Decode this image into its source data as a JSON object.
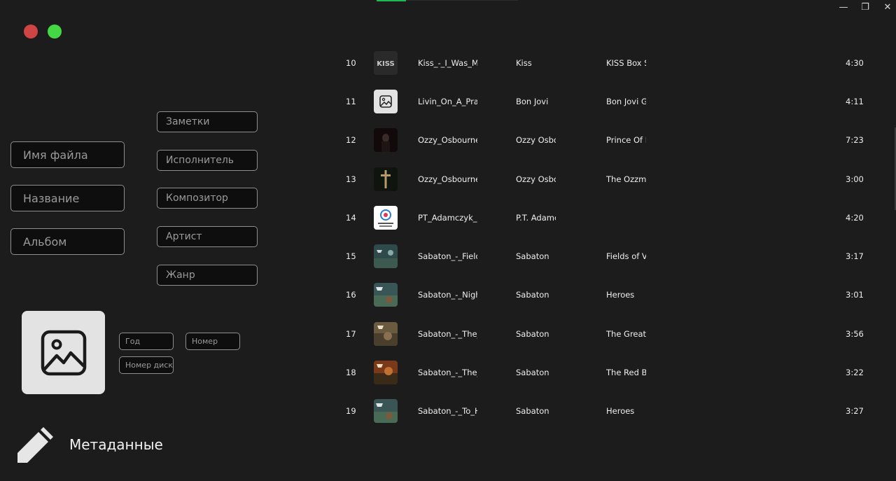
{
  "window": {
    "minimize": "—",
    "maximize": "❐",
    "close": "✕"
  },
  "metadata": {
    "fields": {
      "filename": "Имя файла",
      "title": "Название",
      "album": "Альбом",
      "notes": "Заметки",
      "performer": "Исполнитель",
      "composer": "Композитор",
      "artist": "Артист",
      "genre": "Жанр",
      "year": "Год",
      "track_number": "Номер",
      "disc_number": "Номер диска"
    },
    "section_label": "Метаданные"
  },
  "tracks": [
    {
      "num": "10",
      "title": "Kiss_-_I_Was_Ma",
      "artist": "Kiss",
      "album": "KISS Box Se",
      "duration": "4:30",
      "thumb": "kiss-logo-icon"
    },
    {
      "num": "11",
      "title": "Livin_On_A_Pray",
      "artist": "Bon Jovi",
      "album": "Bon Jovi Gr",
      "duration": "4:11",
      "thumb": "image-placeholder-icon"
    },
    {
      "num": "12",
      "title": "Ozzy_Osbourne_",
      "artist": "Ozzy Osbou",
      "album": "Prince Of D",
      "duration": "7:23",
      "thumb": "album-art"
    },
    {
      "num": "13",
      "title": "Ozzy_Osbourne_",
      "artist": "Ozzy Osbou",
      "album": "The Ozzma",
      "duration": "3:00",
      "thumb": "cross-art"
    },
    {
      "num": "14",
      "title": "PT_Adamczyk_-_",
      "artist": "P.T. Adamcz",
      "album": "",
      "duration": "4:20",
      "thumb": "free-music-logo"
    },
    {
      "num": "15",
      "title": "Sabaton_-_Fields",
      "artist": "Sabaton",
      "album": "Fields of Ve",
      "duration": "3:17",
      "thumb": "album-art"
    },
    {
      "num": "16",
      "title": "Sabaton_-_Night",
      "artist": "Sabaton",
      "album": "Heroes",
      "duration": "3:01",
      "thumb": "album-art"
    },
    {
      "num": "17",
      "title": "Sabaton_-_The_A",
      "artist": "Sabaton",
      "album": "The Great V",
      "duration": "3:56",
      "thumb": "album-art"
    },
    {
      "num": "18",
      "title": "Sabaton_-_The_F",
      "artist": "Sabaton",
      "album": "The Red Ba",
      "duration": "3:22",
      "thumb": "album-art"
    },
    {
      "num": "19",
      "title": "Sabaton_-_To_He",
      "artist": "Sabaton",
      "album": "Heroes",
      "duration": "3:27",
      "thumb": "album-art"
    }
  ],
  "colors": {
    "accent": "#1db954",
    "background": "#1c1c1d",
    "dot_red": "#cf4444",
    "dot_green": "#44d844"
  }
}
